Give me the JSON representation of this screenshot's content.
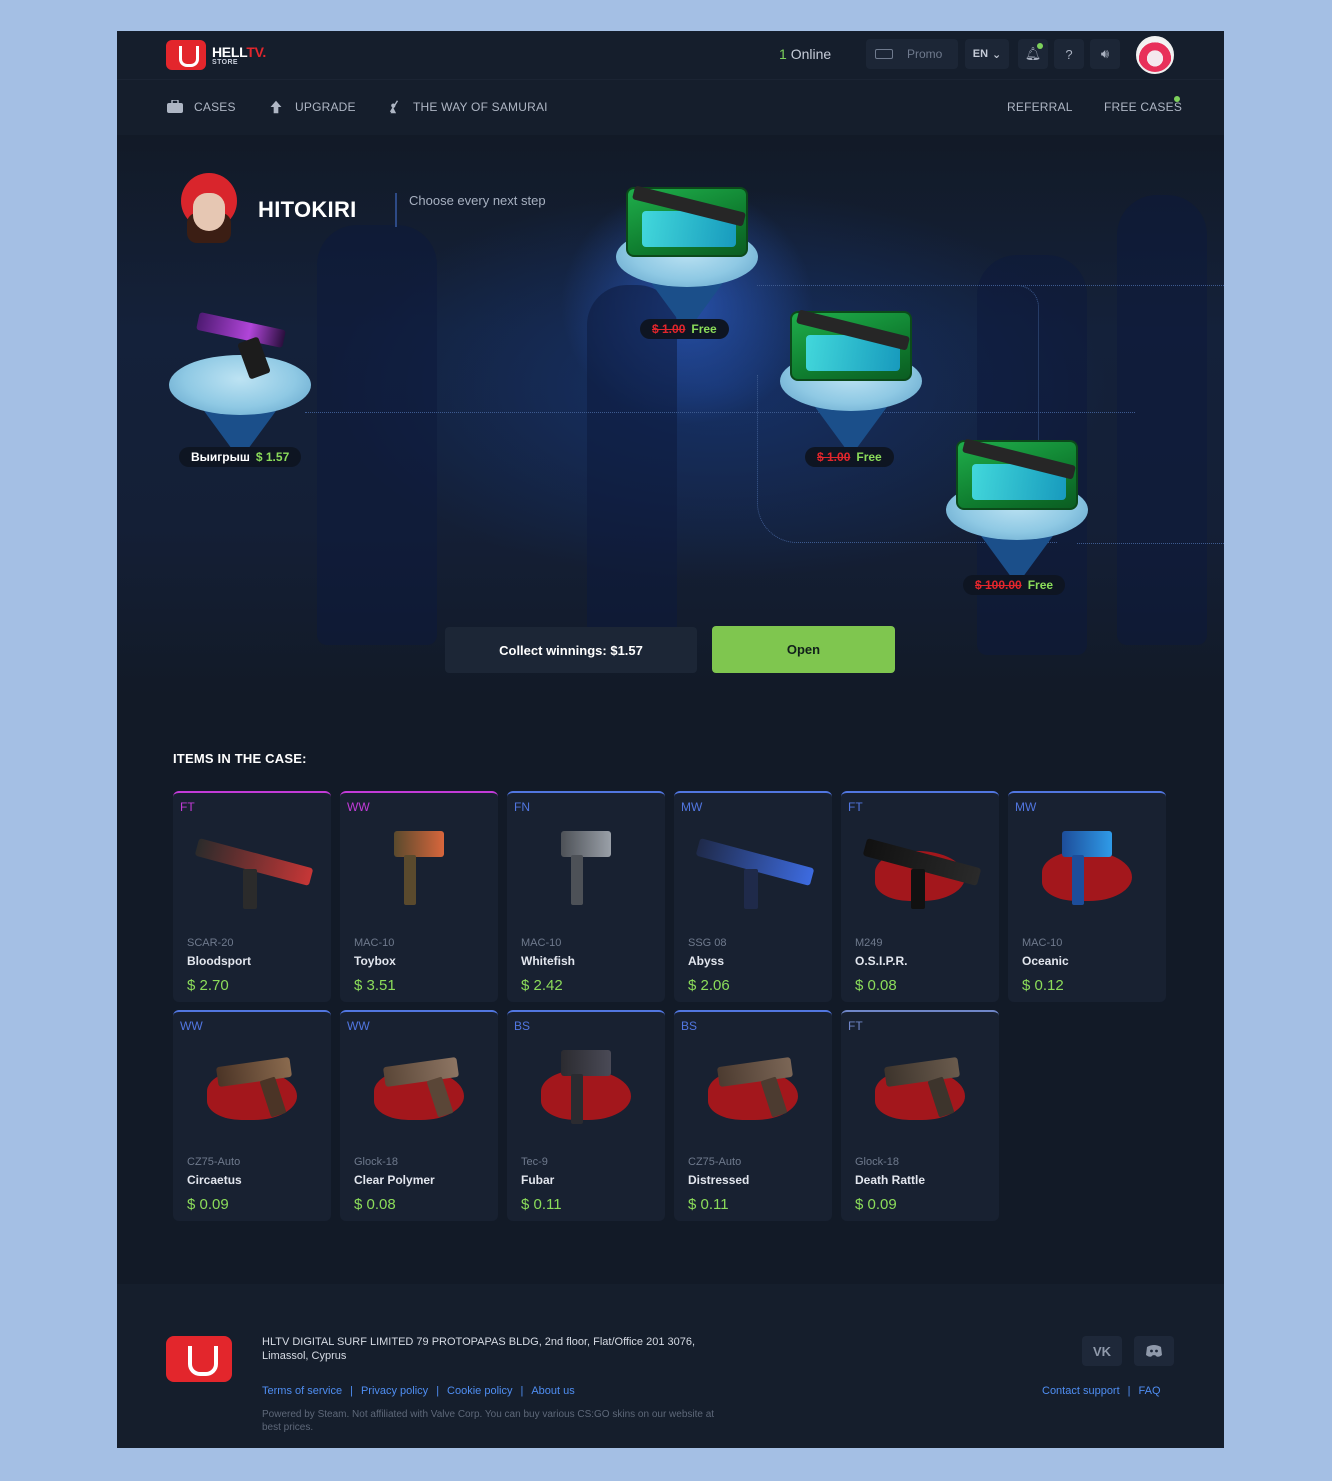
{
  "brand": {
    "name_a": "HELL",
    "name_b": "TV.",
    "sub": "STORE"
  },
  "header": {
    "online_count": "1",
    "online_label": "Online",
    "promo_label": "Promo",
    "lang": "EN"
  },
  "nav": {
    "items": [
      {
        "label": "CASES",
        "icon": "case-icon"
      },
      {
        "label": "UPGRADE",
        "icon": "arrow-up-icon"
      },
      {
        "label": "THE WAY OF SAMURAI",
        "icon": "samurai-icon"
      }
    ],
    "referral": "REFERRAL",
    "free_cases": "FREE CASES"
  },
  "hero": {
    "name": "HITOKIRI",
    "subtitle": "Choose every next step",
    "win": {
      "label": "Выигрыш",
      "value": "$ 1.57"
    },
    "steps": [
      {
        "old": "$ 1.00",
        "free": "Free"
      },
      {
        "old": "$ 1.00",
        "free": "Free"
      },
      {
        "old": "$ 100.00",
        "free": "Free"
      }
    ]
  },
  "actions": {
    "collect": "Collect winnings: $1.57",
    "open": "Open"
  },
  "items_title": "ITEMS IN THE CASE:",
  "items": [
    {
      "wear": "FT",
      "type": "SCAR-20",
      "skin": "Bloodsport",
      "price": "$ 2.70",
      "rarity": "#c23bd8",
      "g1": "#2b2b2b",
      "g2": "#c63636"
    },
    {
      "wear": "WW",
      "type": "MAC-10",
      "skin": "Toybox",
      "price": "$ 3.51",
      "rarity": "#c23bd8",
      "g1": "#5a4a2d",
      "g2": "#d8663c"
    },
    {
      "wear": "FN",
      "type": "MAC-10",
      "skin": "Whitefish",
      "price": "$ 2.42",
      "rarity": "#5176e0",
      "g1": "#4d5157",
      "g2": "#9aa0a8"
    },
    {
      "wear": "MW",
      "type": "SSG 08",
      "skin": "Abyss",
      "price": "$ 2.06",
      "rarity": "#5176e0",
      "g1": "#1f2a4a",
      "g2": "#3d6be0"
    },
    {
      "wear": "FT",
      "type": "M249",
      "skin": "O.S.I.P.R.",
      "price": "$ 0.08",
      "rarity": "#5176e0",
      "g1": "#111111",
      "g2": "#2a2a2a"
    },
    {
      "wear": "MW",
      "type": "MAC-10",
      "skin": "Oceanic",
      "price": "$ 0.12",
      "rarity": "#5176e0",
      "g1": "#1d4d9a",
      "g2": "#2f9be8"
    },
    {
      "wear": "WW",
      "type": "CZ75-Auto",
      "skin": "Circaetus",
      "price": "$ 0.09",
      "rarity": "#5176e0",
      "g1": "#4b3426",
      "g2": "#8a6a4e"
    },
    {
      "wear": "WW",
      "type": "Glock-18",
      "skin": "Clear Polymer",
      "price": "$ 0.08",
      "rarity": "#5176e0",
      "g1": "#5a4637",
      "g2": "#8d7563"
    },
    {
      "wear": "BS",
      "type": "Tec-9",
      "skin": "Fubar",
      "price": "$ 0.11",
      "rarity": "#5176e0",
      "g1": "#2b2b30",
      "g2": "#4a4a56"
    },
    {
      "wear": "BS",
      "type": "CZ75-Auto",
      "skin": "Distressed",
      "price": "$ 0.11",
      "rarity": "#5176e0",
      "g1": "#4c3b30",
      "g2": "#7b6656"
    },
    {
      "wear": "FT",
      "type": "Glock-18",
      "skin": "Death Rattle",
      "price": "$ 0.09",
      "rarity": "#6f86c8",
      "g1": "#3d342c",
      "g2": "#6a5b4d"
    }
  ],
  "footer": {
    "address": "HLTV DIGITAL SURF LIMITED 79 PROTOPAPAS BLDG, 2nd floor, Flat/Office 201 3076, Limassol, Cyprus",
    "links": [
      "Terms of service",
      "Privacy policy",
      "Cookie policy",
      "About us"
    ],
    "note": "Powered by Steam. Not affiliated with Valve Corp. You can buy various CS:GO skins on our website at best prices.",
    "contact": "Contact support",
    "faq": "FAQ",
    "social": [
      "vk-icon",
      "discord-icon"
    ]
  },
  "colors": {
    "accent_green": "#7fc64f",
    "brand_red": "#e3262c",
    "link_blue": "#4f8ef2"
  }
}
